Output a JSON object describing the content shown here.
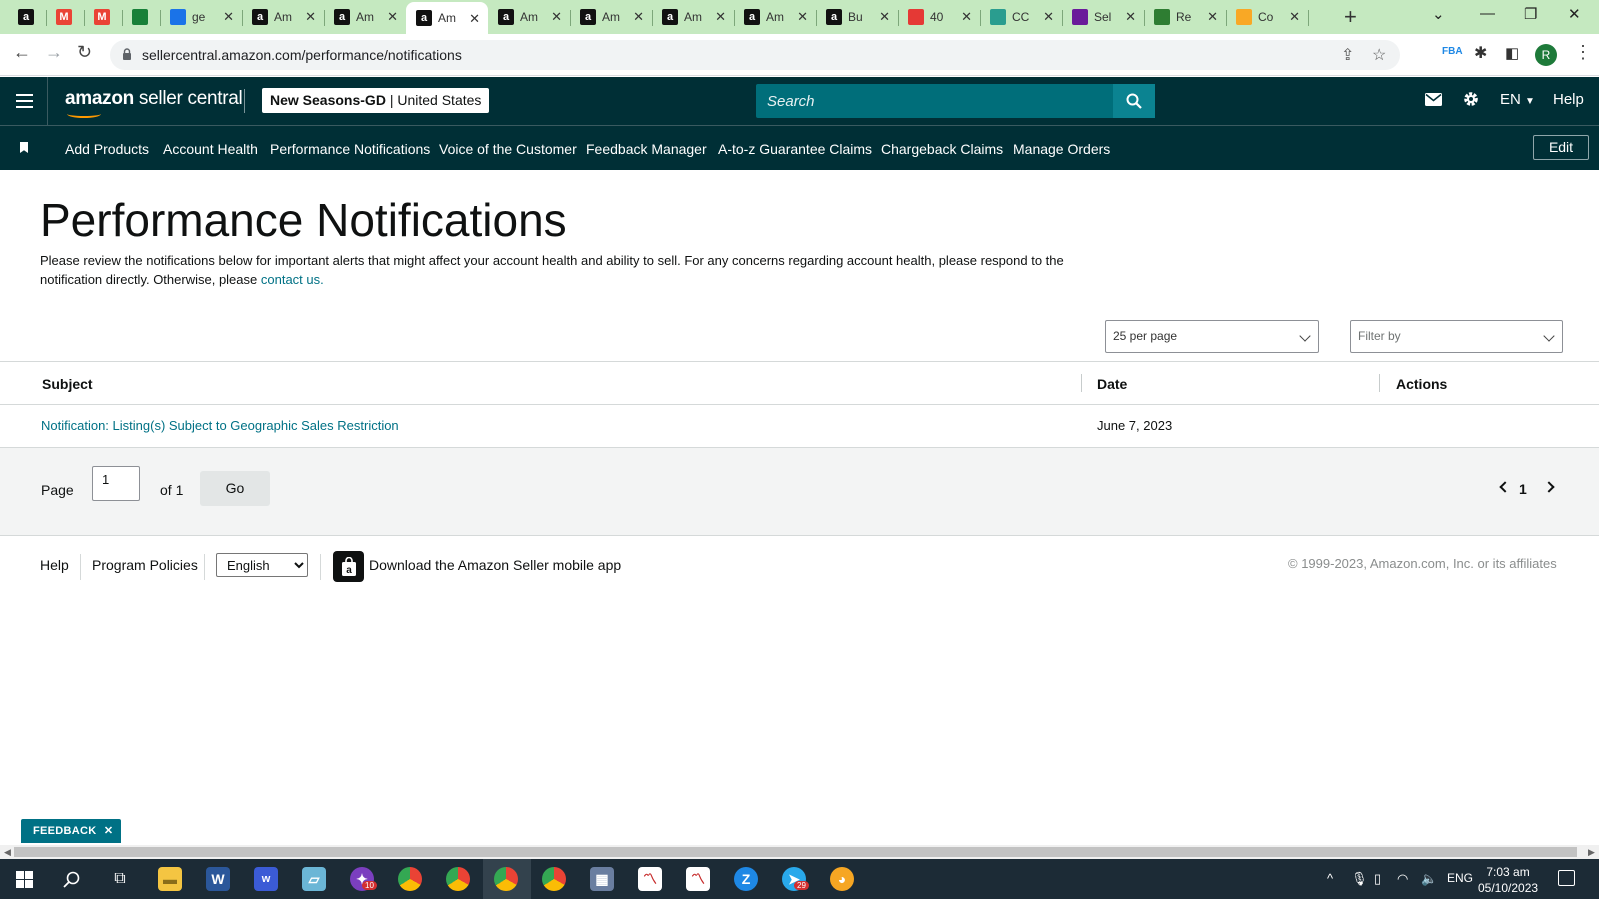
{
  "browser": {
    "tabs": [
      {
        "favicon": "amazon-icon",
        "title": "",
        "color": "#111111"
      },
      {
        "favicon": "gmail-icon",
        "title": "",
        "color": "#ea4335"
      },
      {
        "favicon": "gmail-icon",
        "title": "",
        "color": "#ea4335"
      },
      {
        "favicon": "sheets-plus-icon",
        "title": "",
        "color": "#188038"
      },
      {
        "favicon": "google-icon",
        "title": "ge",
        "color": "#1a73e8"
      },
      {
        "favicon": "amazon-icon",
        "title": "Am",
        "color": "#111111"
      },
      {
        "favicon": "amazon-icon",
        "title": "Am",
        "color": "#111111"
      },
      {
        "favicon": "amazon-icon",
        "title": "Am",
        "color": "#111111",
        "active": true
      },
      {
        "favicon": "amazon-icon",
        "title": "Am",
        "color": "#111111"
      },
      {
        "favicon": "amazon-icon",
        "title": "Am",
        "color": "#111111"
      },
      {
        "favicon": "amazon-icon",
        "title": "Am",
        "color": "#111111"
      },
      {
        "favicon": "amazon-icon",
        "title": "Am",
        "color": "#111111"
      },
      {
        "favicon": "amazon-icon",
        "title": "Bu",
        "color": "#111111"
      },
      {
        "favicon": "colorful-icon",
        "title": "40",
        "color": "#e53935"
      },
      {
        "favicon": "edge-icon",
        "title": "CC",
        "color": "#2a9d8f"
      },
      {
        "favicon": "sn-icon",
        "title": "Sel",
        "color": "#6a1b9a"
      },
      {
        "favicon": "vine-icon",
        "title": "Re",
        "color": "#2e7d32"
      },
      {
        "favicon": "ja-icon",
        "title": "Co",
        "color": "#f9a825"
      }
    ],
    "url": "sellercentral.amazon.com/performance/notifications"
  },
  "header": {
    "logo_amazon": "amazon",
    "logo_rest": " seller central",
    "account_name": "New Seasons-GD",
    "account_sep": " | ",
    "account_region": "United States",
    "search_placeholder": "Search",
    "language": "EN",
    "help": "Help"
  },
  "nav": {
    "items": [
      "Add Products",
      "Account Health",
      "Performance Notifications",
      "Voice of the Customer",
      "Feedback Manager",
      "A-to-z Guarantee Claims",
      "Chargeback Claims",
      "Manage Orders"
    ],
    "edit": "Edit"
  },
  "page": {
    "title": "Performance Notifications",
    "intro": "Please review the notifications below for important alerts that might affect your account health and ability to sell. For any concerns regarding account health, please respond to the notification directly. Otherwise, please ",
    "contact_link": "contact us.",
    "per_page": "25 per page",
    "filter_placeholder": "Filter by"
  },
  "table": {
    "columns": [
      "Subject",
      "Date",
      "Actions"
    ],
    "rows": [
      {
        "subject": "Notification: Listing(s) Subject to Geographic Sales Restriction",
        "date": "June 7, 2023",
        "actions": ""
      }
    ]
  },
  "pager": {
    "page_label": "Page",
    "page_value": "1",
    "of_label": "of 1",
    "go": "Go",
    "current": "1"
  },
  "footer": {
    "help": "Help",
    "policies": "Program Policies",
    "language": "English",
    "app_text": "Download the Amazon Seller mobile app",
    "copyright": "© 1999-2023, Amazon.com, Inc. or its affiliates"
  },
  "feedback": {
    "label": "FEEDBACK",
    "close": "✕"
  },
  "taskbar": {
    "language": "ENG",
    "time": "7:03 am",
    "date": "05/10/2023",
    "badges": {
      "chrome_profile": "10",
      "telegram": "29"
    }
  },
  "colors": {
    "header_bg": "#002f36",
    "search_bg": "#006e7a",
    "link": "#007185",
    "tabstrip_bg": "#c5e9c0"
  }
}
